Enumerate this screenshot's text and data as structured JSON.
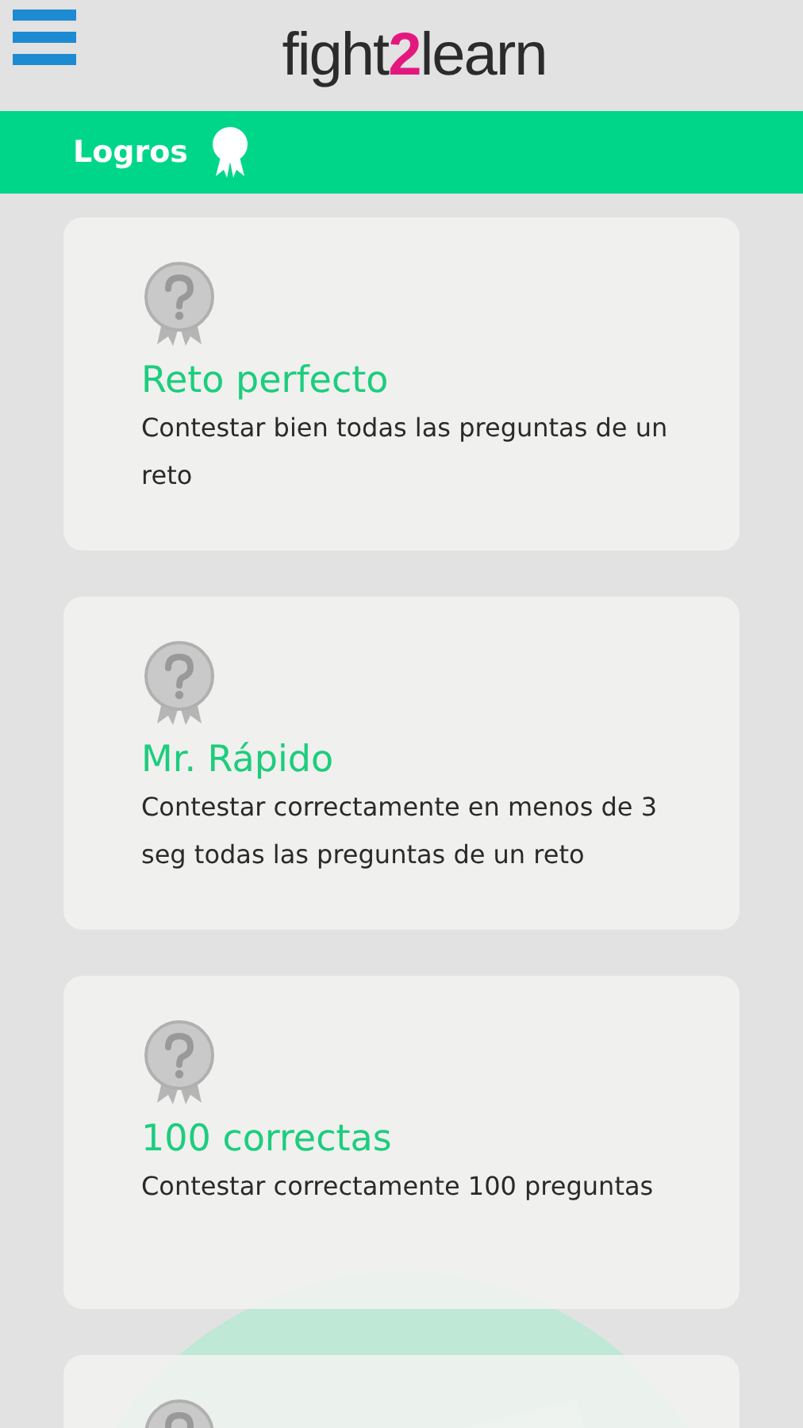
{
  "header": {
    "logo": {
      "before": "fight",
      "number": "2",
      "after": "learn"
    }
  },
  "section_bar": {
    "title": "Logros"
  },
  "achievements": [
    {
      "title": "Reto perfecto",
      "description": "Contestar bien todas las preguntas de un reto",
      "unlocked": false
    },
    {
      "title": "Mr. Rápido",
      "description": "Contestar correctamente en menos de 3 seg todas las preguntas de un reto",
      "unlocked": false
    },
    {
      "title": "100 correctas",
      "description": "Contestar correctamente 100 preguntas",
      "unlocked": false
    },
    {
      "unlocked": false
    }
  ]
}
